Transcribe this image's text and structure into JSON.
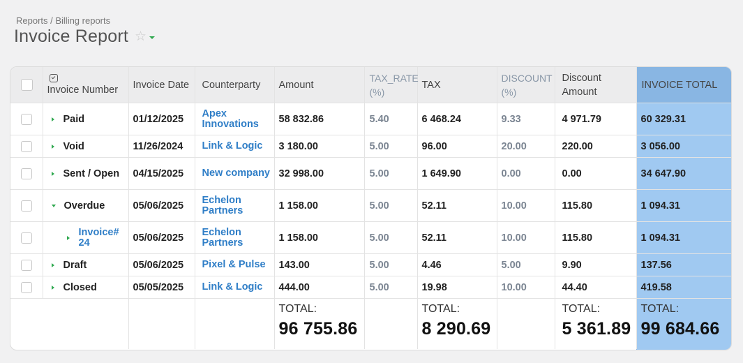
{
  "breadcrumb": "Reports / Billing reports",
  "page_title": "Invoice Report",
  "icons": {
    "favorite": "star-outline-icon",
    "title_menu": "chevron-down-icon",
    "header_action": "column-select-icon",
    "expand": "triangle-right-icon",
    "collapse": "triangle-down-icon"
  },
  "colors": {
    "accent_green": "#2fa84f",
    "link_blue": "#2f7ec7",
    "highlight_column": "#a0c9f1",
    "highlight_header": "#89b6e3"
  },
  "columns": {
    "invoice_number": "Invoice Number",
    "invoice_date": "Invoice Date",
    "counterparty": "Counterparty",
    "amount": "Amount",
    "tax_rate": "TAX_RATE",
    "tax_rate_unit": "(%)",
    "tax": "TAX",
    "discount": "DISCOUNT",
    "discount_unit": "(%)",
    "discount_amount_1": "Discount",
    "discount_amount_2": "Amount",
    "invoice_total": "INVOICE TOTAL"
  },
  "rows": [
    {
      "status": "Paid",
      "date": "01/12/2025",
      "cp1": "Apex",
      "cp2": "Innovations",
      "amount": "58 832.86",
      "tax_rate": "5.40",
      "tax": "6 468.24",
      "discount": "9.33",
      "discount_amount": "4 971.79",
      "total": "60 329.31"
    },
    {
      "status": "Void",
      "date": "11/26/2024",
      "cp1": "Link & Logic",
      "cp2": "",
      "amount": "3 180.00",
      "tax_rate": "5.00",
      "tax": "96.00",
      "discount": "20.00",
      "discount_amount": "220.00",
      "total": "3 056.00"
    },
    {
      "status": "Sent / Open",
      "date": "04/15/2025",
      "cp1": "New company",
      "cp2": "",
      "amount": "32 998.00",
      "tax_rate": "5.00",
      "tax": "1 649.90",
      "discount": "0.00",
      "discount_amount": "0.00",
      "total": "34 647.90"
    },
    {
      "status": "Overdue",
      "date": "05/06/2025",
      "cp1": "Echelon",
      "cp2": "Partners",
      "amount": "1 158.00",
      "tax_rate": "5.00",
      "tax": "52.11",
      "discount": "10.00",
      "discount_amount": "115.80",
      "total": "1 094.31"
    },
    {
      "status": "Invoice#",
      "status2": "24",
      "date": "05/06/2025",
      "cp1": "Echelon",
      "cp2": "Partners",
      "amount": "1 158.00",
      "tax_rate": "5.00",
      "tax": "52.11",
      "discount": "10.00",
      "discount_amount": "115.80",
      "total": "1 094.31"
    },
    {
      "status": "Draft",
      "date": "05/06/2025",
      "cp1": "Pixel & Pulse",
      "cp2": "",
      "amount": "143.00",
      "tax_rate": "5.00",
      "tax": "4.46",
      "discount": "5.00",
      "discount_amount": "9.90",
      "total": "137.56"
    },
    {
      "status": "Closed",
      "date": "05/05/2025",
      "cp1": "Link & Logic",
      "cp2": "",
      "amount": "444.00",
      "tax_rate": "5.00",
      "tax": "19.98",
      "discount": "10.00",
      "discount_amount": "44.40",
      "total": "419.58"
    }
  ],
  "totals": {
    "label": "TOTAL:",
    "amount": "96 755.86",
    "tax": "8 290.69",
    "discount_amount": "5 361.89",
    "invoice_total": "99 684.66"
  }
}
